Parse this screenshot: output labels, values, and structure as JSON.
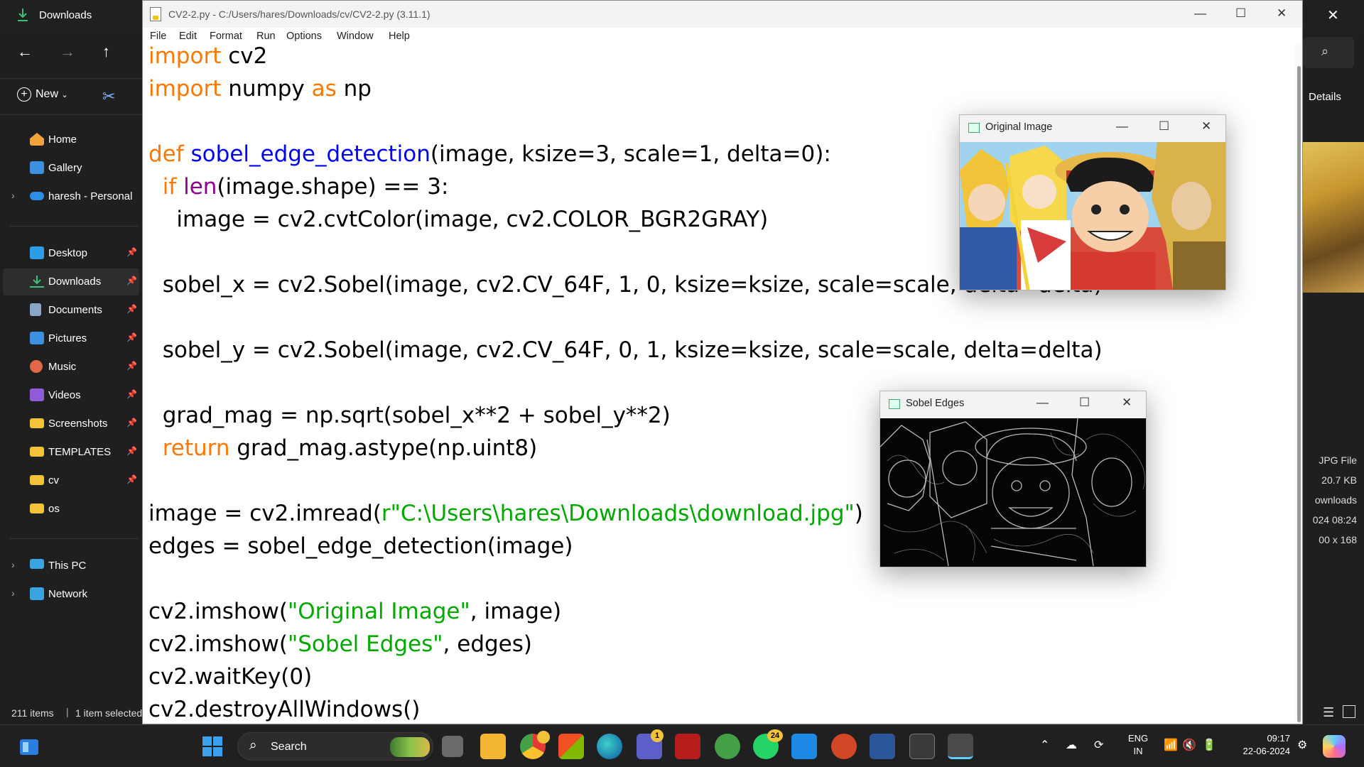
{
  "explorer": {
    "title": "Downloads",
    "new_label": "New",
    "details_label": "Details",
    "sidebar": [
      {
        "label": "Home",
        "color": "#f2a33a"
      },
      {
        "label": "Gallery",
        "color": "#3d8fe0"
      },
      {
        "label": "haresh - Personal",
        "color": "#2d8ee6"
      },
      {
        "label": "Desktop",
        "color": "#2d9ce6"
      },
      {
        "label": "Downloads",
        "color": "#3bbf7a"
      },
      {
        "label": "Documents",
        "color": "#8aa5c8"
      },
      {
        "label": "Pictures",
        "color": "#3d8fe0"
      },
      {
        "label": "Music",
        "color": "#e0674a"
      },
      {
        "label": "Videos",
        "color": "#8e5cd6"
      },
      {
        "label": "Screenshots",
        "color": "#f2c23a"
      },
      {
        "label": "TEMPLATES",
        "color": "#f2c23a"
      },
      {
        "label": "cv",
        "color": "#f2c23a"
      },
      {
        "label": "os",
        "color": "#f2c23a"
      },
      {
        "label": "This PC",
        "color": "#3aa4e0"
      },
      {
        "label": "Network",
        "color": "#3aa4e0"
      }
    ],
    "status_items": "211 items",
    "status_selected": "1 item selected",
    "details_meta": [
      "JPG File",
      "20.7 KB",
      "ownloads",
      "024 08:24",
      "00 x 168"
    ]
  },
  "idle": {
    "title": "CV2-2.py - C:/Users/hares/Downloads/cv/CV2-2.py (3.11.1)",
    "menu": [
      "File",
      "Edit",
      "Format",
      "Run",
      "Options",
      "Window",
      "Help"
    ],
    "code": {
      "l1_kw": "import",
      "l1_rest": " cv2",
      "l2_kw": "import",
      "l2_mid": " numpy ",
      "l2_kw2": "as",
      "l2_rest": " np",
      "l4_kw": "def",
      "l4_fn": " sobel_edge_detection",
      "l4_rest": "(image, ksize=3, scale=1, delta=0):",
      "l5_kw": "  if",
      "l5_bi": " len",
      "l5_rest": "(image.shape) == 3:",
      "l6": "    image = cv2.cvtColor(image, cv2.COLOR_BGR2GRAY)",
      "l8": "  sobel_x = cv2.Sobel(image, cv2.CV_64F, 1, 0, ksize=ksize, scale=scale, delta=delta)",
      "l10": "  sobel_y = cv2.Sobel(image, cv2.CV_64F, 0, 1, ksize=ksize, scale=scale, delta=delta)",
      "l12": "  grad_mag = np.sqrt(sobel_x**2 + sobel_y**2)",
      "l13_kw": "  return",
      "l13_rest": " grad_mag.astype(np.uint8)",
      "l15_a": "image = cv2.imread(",
      "l15_st": "r\"C:\\Users\\hares\\Downloads\\download.jpg\"",
      "l15_b": ")",
      "l16": "edges = sobel_edge_detection(image)",
      "l18_a": "cv2.imshow(",
      "l18_st": "\"Original Image\"",
      "l18_b": ", image)",
      "l19_a": "cv2.imshow(",
      "l19_st": "\"Sobel Edges\"",
      "l19_b": ", edges)",
      "l20": "cv2.waitKey(0)",
      "l21": "cv2.destroyAllWindows()"
    }
  },
  "windows": {
    "original_title": "Original Image",
    "sobel_title": "Sobel Edges"
  },
  "taskbar": {
    "search_label": "Search",
    "badges": {
      "chrome": "",
      "teams": "1",
      "whatsapp": "24"
    },
    "lang_1": "ENG",
    "lang_2": "IN",
    "time": "09:17",
    "date": "22-06-2024"
  },
  "colors": {
    "keyword": "#ff7700",
    "function_name": "#0000ff",
    "builtin": "#900090",
    "string": "#00aa00",
    "accent": "#0078d4"
  }
}
